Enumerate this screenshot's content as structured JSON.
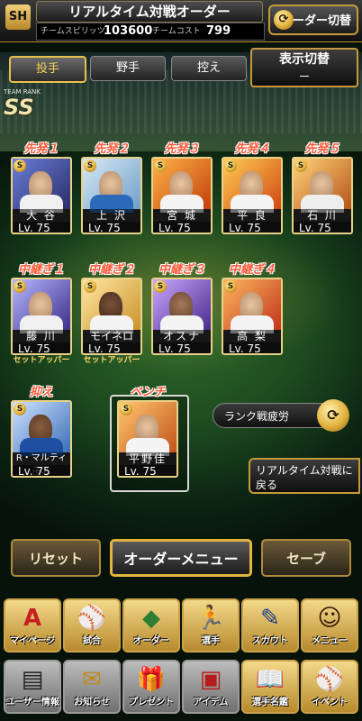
{
  "header": {
    "logo": "SH",
    "title": "リアルタイム対戦オーダー",
    "spirit_label": "チームスピリッツ",
    "spirit_value": "103600",
    "cost_label": "チームコスト",
    "cost_value": "799",
    "order_switch_label": "オーダー切替"
  },
  "tabs": [
    {
      "label": "投手",
      "active": true
    },
    {
      "label": "野手",
      "active": false
    },
    {
      "label": "控え",
      "active": false
    }
  ],
  "display_switch": {
    "label": "表示切替",
    "value": "ー"
  },
  "team_rank": {
    "label": "TEAM RANK",
    "value": "SS"
  },
  "starters": [
    {
      "position": "先発１",
      "name": "大 谷",
      "level": "Lv. 75"
    },
    {
      "position": "先発２",
      "name": "上 沢",
      "level": "Lv. 75"
    },
    {
      "position": "先発３",
      "name": "宮 城",
      "level": "Lv. 75"
    },
    {
      "position": "先発４",
      "name": "平 良",
      "level": "Lv. 75"
    },
    {
      "position": "先発５",
      "name": "石 川",
      "level": "Lv. 75"
    }
  ],
  "relievers": [
    {
      "position": "中継ぎ１",
      "name": "藤 川",
      "level": "Lv. 75",
      "role": "セットアッパー"
    },
    {
      "position": "中継ぎ２",
      "name": "モイネロ",
      "level": "Lv. 75",
      "role": "セットアッパー"
    },
    {
      "position": "中継ぎ３",
      "name": "オスナ",
      "level": "Lv. 75",
      "role": ""
    },
    {
      "position": "中継ぎ４",
      "name": "高 梨",
      "level": "Lv. 75",
      "role": ""
    }
  ],
  "closer": {
    "position": "抑え",
    "name": "R・マルティネス",
    "level": "Lv. 75"
  },
  "bench": {
    "position": "ベンチ",
    "name": "平野佳",
    "level": "Lv. 75"
  },
  "rank_fatigue": {
    "label": "ランク戦疲労"
  },
  "back_button": {
    "label": "リアルタイム対戦に戻る"
  },
  "actions": {
    "reset": "リセット",
    "order_menu": "オーダーメニュー",
    "save": "セーブ"
  },
  "nav_top": [
    {
      "label": "マイページ",
      "icon": "A"
    },
    {
      "label": "試合",
      "icon": "⚾"
    },
    {
      "label": "オーダー",
      "icon": "◆"
    },
    {
      "label": "選手",
      "icon": "🏃"
    },
    {
      "label": "スカウト",
      "icon": "✎"
    },
    {
      "label": "メニュー",
      "icon": "☺"
    }
  ],
  "nav_bottom": [
    {
      "label": "ユーザー情報",
      "icon": "▤"
    },
    {
      "label": "お知らせ",
      "icon": "✉"
    },
    {
      "label": "プレゼント",
      "icon": "🎁"
    },
    {
      "label": "アイテム",
      "icon": "▣"
    },
    {
      "label": "選手名鑑",
      "icon": "📖"
    },
    {
      "label": "イベント",
      "icon": "⚾"
    }
  ],
  "colors": {
    "gold": "#e3b53e",
    "position_red": "#ff5a3a",
    "role_yellow": "#ffd86a"
  }
}
